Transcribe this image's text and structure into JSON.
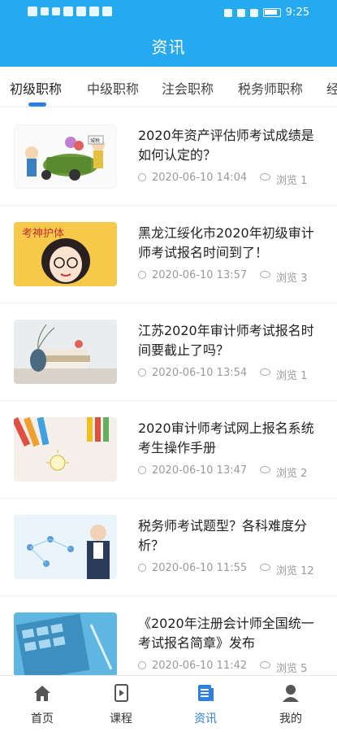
{
  "status_bar": {
    "time": "9:25"
  },
  "header": {
    "title": "资讯"
  },
  "tabs": [
    {
      "label": "初级职称",
      "active": true
    },
    {
      "label": "中级职称",
      "active": false
    },
    {
      "label": "注会职称",
      "active": false
    },
    {
      "label": "税务师职称",
      "active": false
    },
    {
      "label": "经",
      "active": false
    }
  ],
  "news": [
    {
      "title": "2020年资产评估师考试成绩是如何认定的？",
      "date": "2020-06-10 14:04",
      "views": "浏览 1",
      "thumb_icon": "cart-cartoon-image"
    },
    {
      "title": "黑龙江绥化市2020年初级审计师考试报名时间到了！",
      "date": "2020-06-10 13:57",
      "views": "浏览 3",
      "thumb_icon": "exam-girl-cartoon-image"
    },
    {
      "title": "江苏2020年审计师考试报名时间要截止了吗？",
      "date": "2020-06-10 13:54",
      "views": "浏览 1",
      "thumb_icon": "books-vase-image"
    },
    {
      "title": "2020审计师考试网上报名系统考生操作手册",
      "date": "2020-06-10 13:47",
      "views": "浏览 2",
      "thumb_icon": "pencils-lightbulb-image"
    },
    {
      "title": "税务师考试题型？各科难度分析？",
      "date": "2020-06-10 11:55",
      "views": "浏览 12",
      "thumb_icon": "teacher-diagram-image"
    },
    {
      "title": "《2020年注册会计师全国统一考试报名简章》发布",
      "date": "2020-06-10 11:42",
      "views": "浏览 5",
      "thumb_icon": "calculator-image"
    }
  ],
  "thumb_texts": {
    "cart_tag": "城税",
    "exam_banner": "考神护体"
  },
  "bottom_nav": [
    {
      "label": "首页",
      "icon": "home-icon",
      "active": false
    },
    {
      "label": "课程",
      "icon": "course-icon",
      "active": false
    },
    {
      "label": "资讯",
      "icon": "news-icon",
      "active": true
    },
    {
      "label": "我的",
      "icon": "profile-icon",
      "active": false
    }
  ],
  "colors": {
    "primary": "#27a9f0",
    "active": "#2d7fe0",
    "inactive_icon": "#555555"
  }
}
